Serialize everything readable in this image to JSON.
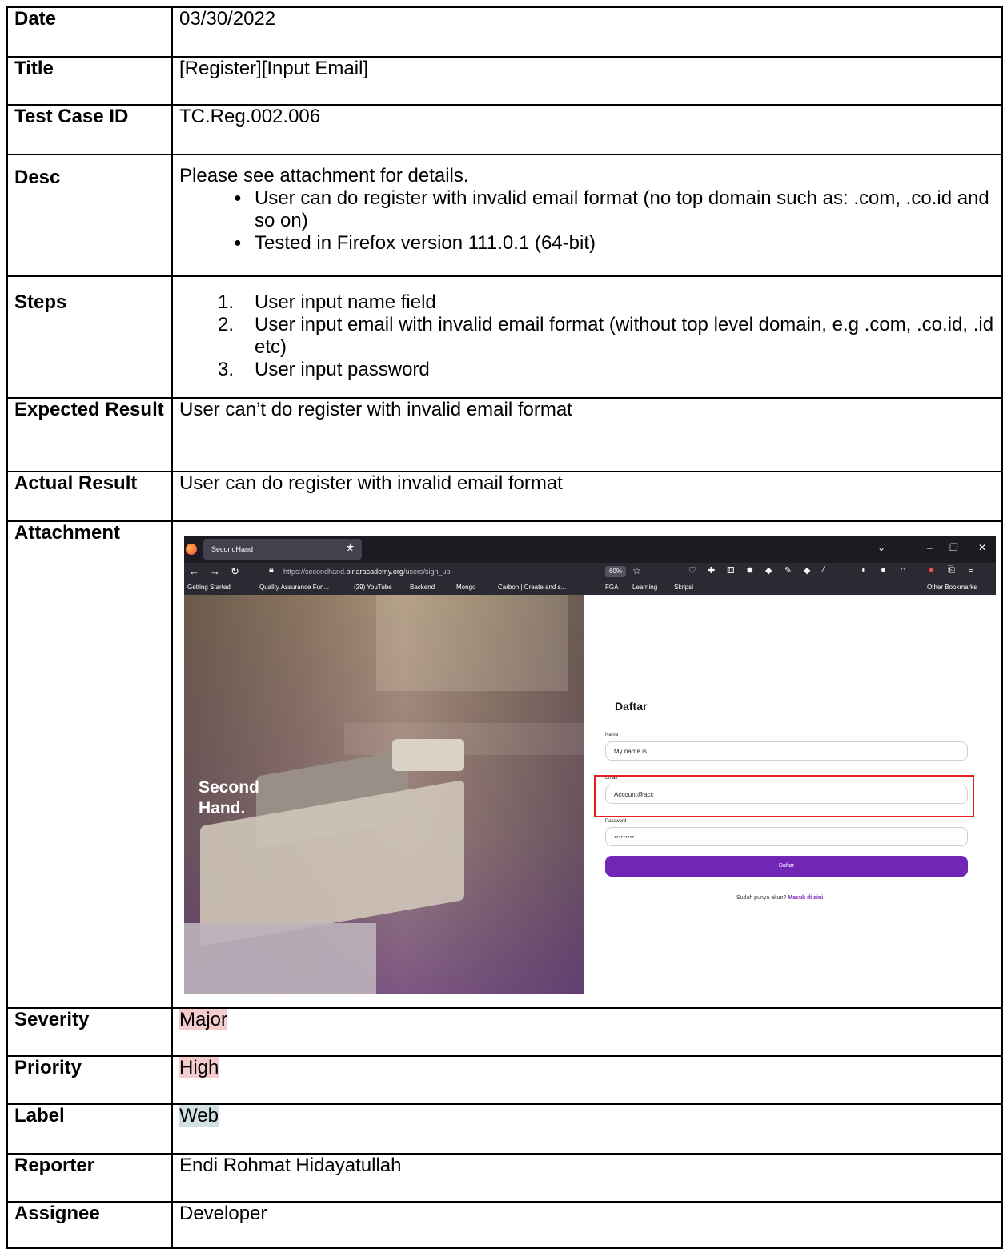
{
  "rows": {
    "date": {
      "label": "Date",
      "value": "03/30/2022"
    },
    "title": {
      "label": "Title",
      "value": "[Register][Input Email]"
    },
    "test_case_id": {
      "label": "Test Case ID",
      "value": "TC.Reg.002.006"
    },
    "desc": {
      "label": "Desc",
      "intro": "Please see attachment for details.",
      "bullets": [
        "User can do register with invalid email format (no top domain such as: .com, .co.id and so on)",
        "Tested in Firefox version 111.0.1 (64-bit)"
      ]
    },
    "steps": {
      "label": "Steps",
      "items": [
        {
          "num": "1.",
          "text": " User input name field"
        },
        {
          "num": "2.",
          "text": "User input email with invalid email format (without top level domain, e.g .com, .co.id, .id etc)"
        },
        {
          "num": "3.",
          "text": "User input password"
        }
      ]
    },
    "expected": {
      "label": "Expected Result",
      "value": "User can’t do register with invalid email format"
    },
    "actual": {
      "label": "Actual Result",
      "value": "User can do register with invalid email format"
    },
    "attachment": {
      "label": "Attachment"
    },
    "severity": {
      "label": "Severity",
      "value": "Major"
    },
    "priority": {
      "label": "Priority",
      "value": "High"
    },
    "label": {
      "label": "Label",
      "value": "Web"
    },
    "reporter": {
      "label": "Reporter",
      "value": "Endi Rohmat Hidayatullah"
    },
    "assignee": {
      "label": "Assignee",
      "value": "Developer"
    }
  },
  "highlight_colors": {
    "severity": "#f4cccc",
    "priority": "#f4cccc",
    "label": "#d0e0e3"
  },
  "screenshot": {
    "tab_title": "SecondHand",
    "url_prefix": "https://secondhand.",
    "url_domain": "binaracademy.org",
    "url_path": "/users/sign_up",
    "zoom": "60%",
    "bookmarks": [
      "Getting Started",
      "Quality Assurance Fun...",
      "(29) YouTube",
      "Backend",
      "Mongo",
      "Carbon | Create and s...",
      "FGA",
      "Learning",
      "Skripsi"
    ],
    "other_bookmarks": "Other Bookmarks",
    "brand_line1": "Second",
    "brand_line2": "Hand.",
    "form_title": "Daftar",
    "name_label": "Nama",
    "name_value": "My name is",
    "email_label": "Email",
    "email_value": "Account@acc",
    "password_label": "Password",
    "password_value": "•••••••••",
    "submit_label": "Daftar",
    "signin_text": "Sudah punya akun?",
    "signin_link": "Masuk di sini",
    "accent": "#7126b5",
    "highlight_box_color": "#e02020"
  }
}
